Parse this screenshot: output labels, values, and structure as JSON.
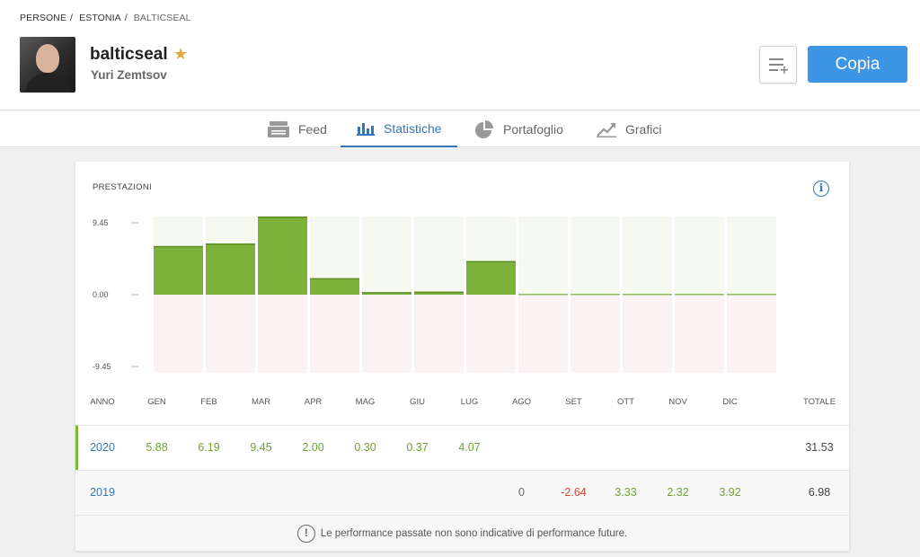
{
  "breadcrumb": [
    "PERSONE",
    "ESTONIA",
    "BALTICSEAL"
  ],
  "profile": {
    "username": "balticseal",
    "full_name": "Yuri Zemtsov"
  },
  "actions": {
    "copy_label": "Copia"
  },
  "tabs": [
    {
      "label": "Feed",
      "icon": "feed-icon",
      "active": false
    },
    {
      "label": "Statistiche",
      "icon": "bar-chart-icon",
      "active": true
    },
    {
      "label": "Portafoglio",
      "icon": "pie-chart-icon",
      "active": false
    },
    {
      "label": "Grafici",
      "icon": "trend-icon",
      "active": false
    }
  ],
  "performance": {
    "title": "PRESTAZIONI",
    "year_header": "ANNO",
    "total_header": "TOTALE",
    "months": [
      "GEN",
      "FEB",
      "MAR",
      "APR",
      "MAG",
      "GIU",
      "LUG",
      "AGO",
      "SET",
      "OTT",
      "NOV",
      "DIC"
    ],
    "rows": [
      {
        "year": "2020",
        "values": [
          "5.88",
          "6.19",
          "9.45",
          "2.00",
          "0.30",
          "0.37",
          "4.07",
          "",
          "",
          "",
          "",
          ""
        ],
        "total": "31.53"
      },
      {
        "year": "2019",
        "values": [
          "",
          "",
          "",
          "",
          "",
          "",
          "",
          "0",
          "-2.64",
          "3.33",
          "2.32",
          "3.92"
        ],
        "total": "6.98"
      }
    ],
    "disclaimer": "Le performance passate non sono indicative di performance future."
  },
  "colors": {
    "accent": "#3476b8",
    "copy_button": "#3d95e6",
    "positive": "#7db83b",
    "negative": "#e0453a",
    "star": "#e2a93b"
  },
  "chart_data": {
    "type": "bar",
    "categories": [
      "GEN",
      "FEB",
      "MAR",
      "APR",
      "MAG",
      "GIU",
      "LUG",
      "AGO",
      "SET",
      "OTT",
      "NOV",
      "DIC"
    ],
    "values": [
      5.88,
      6.19,
      9.45,
      2.0,
      0.3,
      0.37,
      4.07,
      0,
      0,
      0,
      0,
      0
    ],
    "yticks": [
      "9.45",
      "0.00",
      "-9.45"
    ],
    "ylim": [
      -9.45,
      9.45
    ],
    "grid": false,
    "legend": "none"
  }
}
